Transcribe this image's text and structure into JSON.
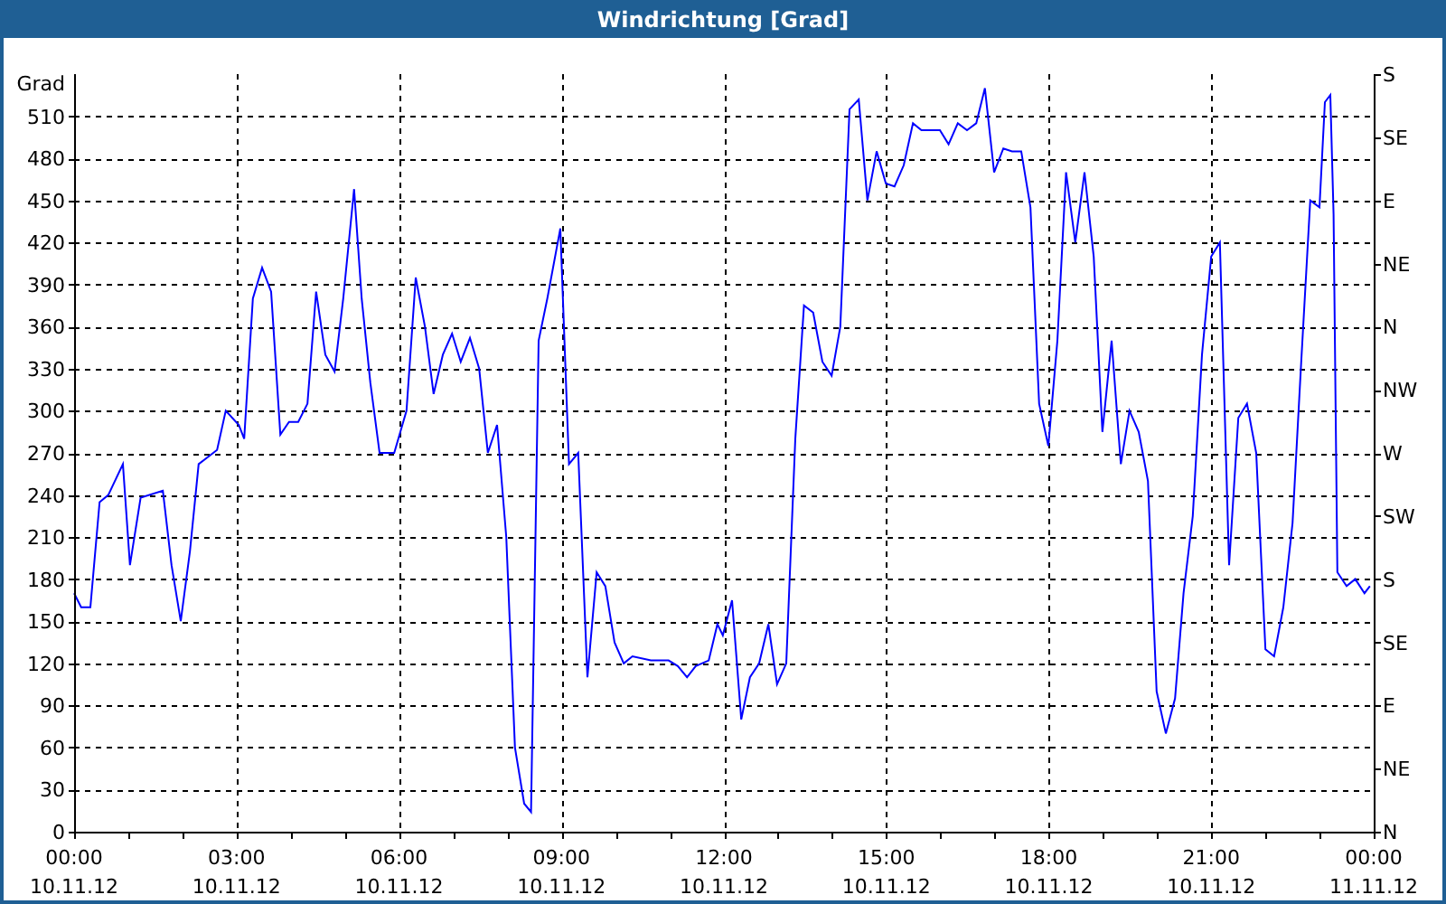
{
  "chart_data": {
    "type": "line",
    "title": "Windrichtung [Grad]",
    "ylabel": "Grad",
    "xlim": [
      0,
      24
    ],
    "ylim": [
      0,
      540
    ],
    "xticks": [
      {
        "value": 0,
        "label": "00:00"
      },
      {
        "value": 3,
        "label": "03:00"
      },
      {
        "value": 6,
        "label": "06:00"
      },
      {
        "value": 9,
        "label": "09:00"
      },
      {
        "value": 12,
        "label": "12:00"
      },
      {
        "value": 15,
        "label": "15:00"
      },
      {
        "value": 18,
        "label": "18:00"
      },
      {
        "value": 21,
        "label": "21:00"
      },
      {
        "value": 24,
        "label": "00:00"
      }
    ],
    "annotations": [
      "10.11.12",
      "10.11.12",
      "10.11.12",
      "10.11.12",
      "10.11.12",
      "10.11.12",
      "10.11.12",
      "10.11.12",
      "11.11.12"
    ],
    "grid": true,
    "yticks": [
      0,
      30,
      60,
      90,
      120,
      150,
      180,
      210,
      240,
      270,
      300,
      330,
      360,
      390,
      420,
      450,
      480,
      510
    ],
    "x": [
      0,
      0.13,
      0.3,
      0.47,
      0.63,
      0.9,
      1.03,
      1.23,
      1.64,
      1.8,
      1.97,
      2.14,
      2.3,
      2.64,
      2.8,
      3.04,
      3.14,
      3.3,
      3.47,
      3.64,
      3.81,
      3.97,
      4.14,
      4.31,
      4.47,
      4.64,
      4.81,
      4.97,
      5.17,
      5.31,
      5.47,
      5.64,
      5.91,
      6.14,
      6.31,
      6.48,
      6.64,
      6.81,
      6.98,
      7.14,
      7.31,
      7.48,
      7.64,
      7.81,
      7.98,
      8.14,
      8.31,
      8.44,
      8.58,
      8.74,
      8.98,
      9.14,
      9.31,
      9.48,
      9.65,
      9.81,
      9.98,
      10.15,
      10.31,
      10.65,
      10.98,
      11.15,
      11.32,
      11.48,
      11.72,
      11.88,
      11.98,
      12.15,
      12.32,
      12.48,
      12.65,
      12.82,
      12.98,
      13.15,
      13.32,
      13.48,
      13.65,
      13.82,
      13.99,
      14.15,
      14.32,
      14.49,
      14.65,
      14.82,
      14.99,
      15.15,
      15.32,
      15.49,
      15.65,
      15.82,
      15.99,
      16.15,
      16.32,
      16.49,
      16.66,
      16.82,
      16.99,
      17.16,
      17.32,
      17.49,
      17.66,
      17.82,
      17.99,
      18.16,
      18.32,
      18.49,
      18.66,
      18.83,
      18.99,
      19.16,
      19.33,
      19.49,
      19.66,
      19.83,
      19.99,
      20.16,
      20.33,
      20.49,
      20.66,
      20.83,
      21,
      21.16,
      21.33,
      21.5,
      21.66,
      21.83,
      22,
      22.16,
      22.33,
      22.5,
      22.66,
      22.83,
      23,
      23.1,
      23.2,
      23.26,
      23.33,
      23.5,
      23.66,
      23.83,
      23.93
    ],
    "series": [
      {
        "color": "#0000ff",
        "values": [
          170,
          160,
          160,
          235,
          240,
          262,
          190,
          238,
          243,
          190,
          150,
          200,
          262,
          272,
          300,
          290,
          280,
          380,
          402,
          385,
          283,
          292,
          292,
          305,
          385,
          340,
          328,
          380,
          458,
          380,
          320,
          270,
          270,
          300,
          395,
          360,
          312,
          340,
          355,
          335,
          352,
          330,
          270,
          290,
          210,
          60,
          20,
          14,
          350,
          380,
          430,
          262,
          270,
          110,
          185,
          175,
          135,
          120,
          125,
          122,
          122,
          118,
          110,
          118,
          122,
          148,
          140,
          165,
          80,
          110,
          120,
          148,
          105,
          120,
          280,
          375,
          370,
          335,
          325,
          360,
          515,
          522,
          450,
          485,
          462,
          460,
          475,
          505,
          500,
          500,
          500,
          490,
          505,
          500,
          505,
          530,
          470,
          487,
          485,
          485,
          445,
          305,
          275,
          350,
          470,
          420,
          470,
          410,
          285,
          350,
          262,
          300,
          285,
          250,
          100,
          70,
          95,
          170,
          225,
          340,
          410,
          420,
          190,
          295,
          305,
          270,
          130,
          125,
          160,
          220,
          335,
          450,
          445,
          520,
          525,
          440,
          185,
          175,
          180,
          170,
          175
        ]
      }
    ]
  },
  "direction_axis": {
    "labels": [
      "S",
      "SE",
      "E",
      "NE",
      "N",
      "NW",
      "W",
      "SW",
      "S",
      "SE",
      "E",
      "NE",
      "N"
    ]
  }
}
